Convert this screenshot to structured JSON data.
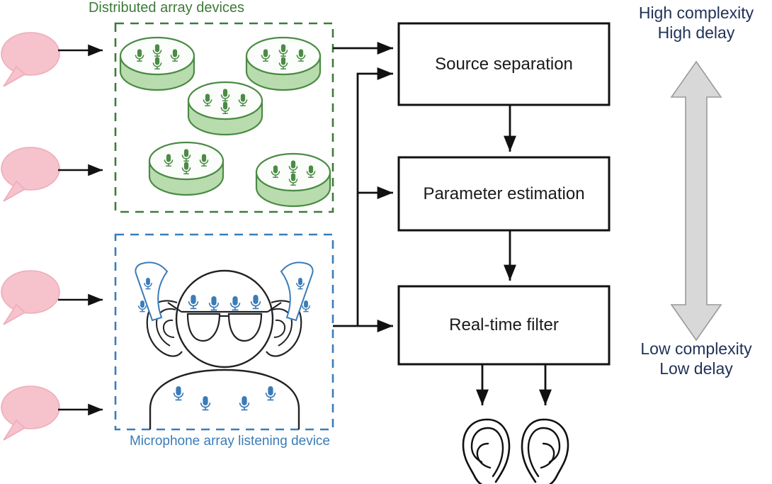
{
  "groups": {
    "distributed": {
      "caption": "Distributed array devices",
      "border_color": "#3e7a3a",
      "device_count": 5,
      "mics_per_device": 4
    },
    "listening": {
      "caption": "Microphone array listening device",
      "border_color": "#3b7cb8",
      "glasses_mics": 4,
      "body_mics": 4,
      "hearing_aids": 2,
      "hearing_aid_mics": 2
    }
  },
  "sources": {
    "label": "speech-bubble",
    "count": 4,
    "color": "#f6c2cb"
  },
  "pipeline": {
    "boxes": [
      {
        "id": "source-separation",
        "label": "Source separation"
      },
      {
        "id": "parameter-estimation",
        "label": "Parameter estimation"
      },
      {
        "id": "real-time-filter",
        "label": "Real-time filter"
      }
    ]
  },
  "outputs": {
    "label": "ear",
    "count": 2
  },
  "complexity_scale": {
    "top_line1": "High complexity",
    "top_line2": "High delay",
    "bottom_line1": "Low complexity",
    "bottom_line2": "Low delay",
    "arrow_color": "#d4d4d4",
    "text_color": "#1f3257"
  },
  "colors": {
    "green_dark": "#4b8b45",
    "green_light": "#b9dcae",
    "blue": "#3b7cb8",
    "pink": "#f6c2cb",
    "pink_stroke": "#e9a7b4",
    "ink": "#1a1a1a",
    "gray_arrow": "#d4d4d4"
  }
}
